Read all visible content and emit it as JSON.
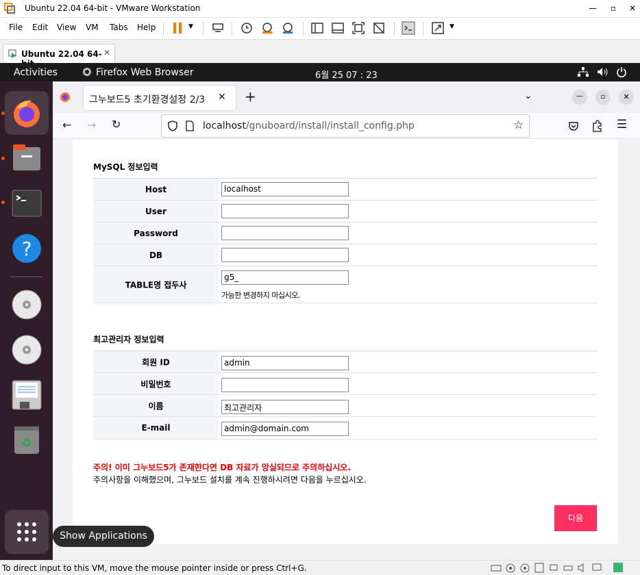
{
  "vmware": {
    "window_title": "Ubuntu 22.04 64-bit - VMware Workstation",
    "menu": [
      "File",
      "Edit",
      "View",
      "VM",
      "Tabs",
      "Help"
    ],
    "tab_label": "Ubuntu 22.04 64-bit",
    "status_text": "To direct input to this VM, move the mouse pointer inside or press Ctrl+G."
  },
  "ubuntu": {
    "activities": "Activities",
    "active_app": "Firefox Web Browser",
    "clock": "6월 25  07 : 23",
    "tooltip": "Show Applications"
  },
  "firefox": {
    "tab_title": "그누보드5 초기환경설정 2/3",
    "url_host": "localhost",
    "url_path": "/gnuboard/install/install_config.php"
  },
  "form": {
    "mysql_title": "MySQL 정보입력",
    "mysql_rows": {
      "host": {
        "label": "Host",
        "value": ""
      },
      "user": {
        "label": "User",
        "value": ""
      },
      "password": {
        "label": "Password",
        "value": ""
      },
      "db": {
        "label": "DB",
        "value": ""
      },
      "prefix": {
        "label": "TABLE명 접두사",
        "value": "g5_",
        "help": "가능한 변경하지 마십시오."
      }
    },
    "admin_title": "최고관리자 정보입력",
    "admin_rows": {
      "id": {
        "label": "회원 ID",
        "value": "admin"
      },
      "pw": {
        "label": "비밀번호",
        "value": ""
      },
      "name": {
        "label": "이름",
        "value": "최고관리자"
      },
      "email": {
        "label": "E-mail",
        "value": "admin@domain.com"
      }
    },
    "warning": "주의! 이미 그누보드5가 존재한다면 DB 자료가 망실되므로 주의하십시오.",
    "notice": "주의사항을 이해했으며, 그누보드 설치를 계속 진행하시려면 다음을 누르십시오.",
    "next_label": "다음"
  },
  "host_value": "localhost"
}
